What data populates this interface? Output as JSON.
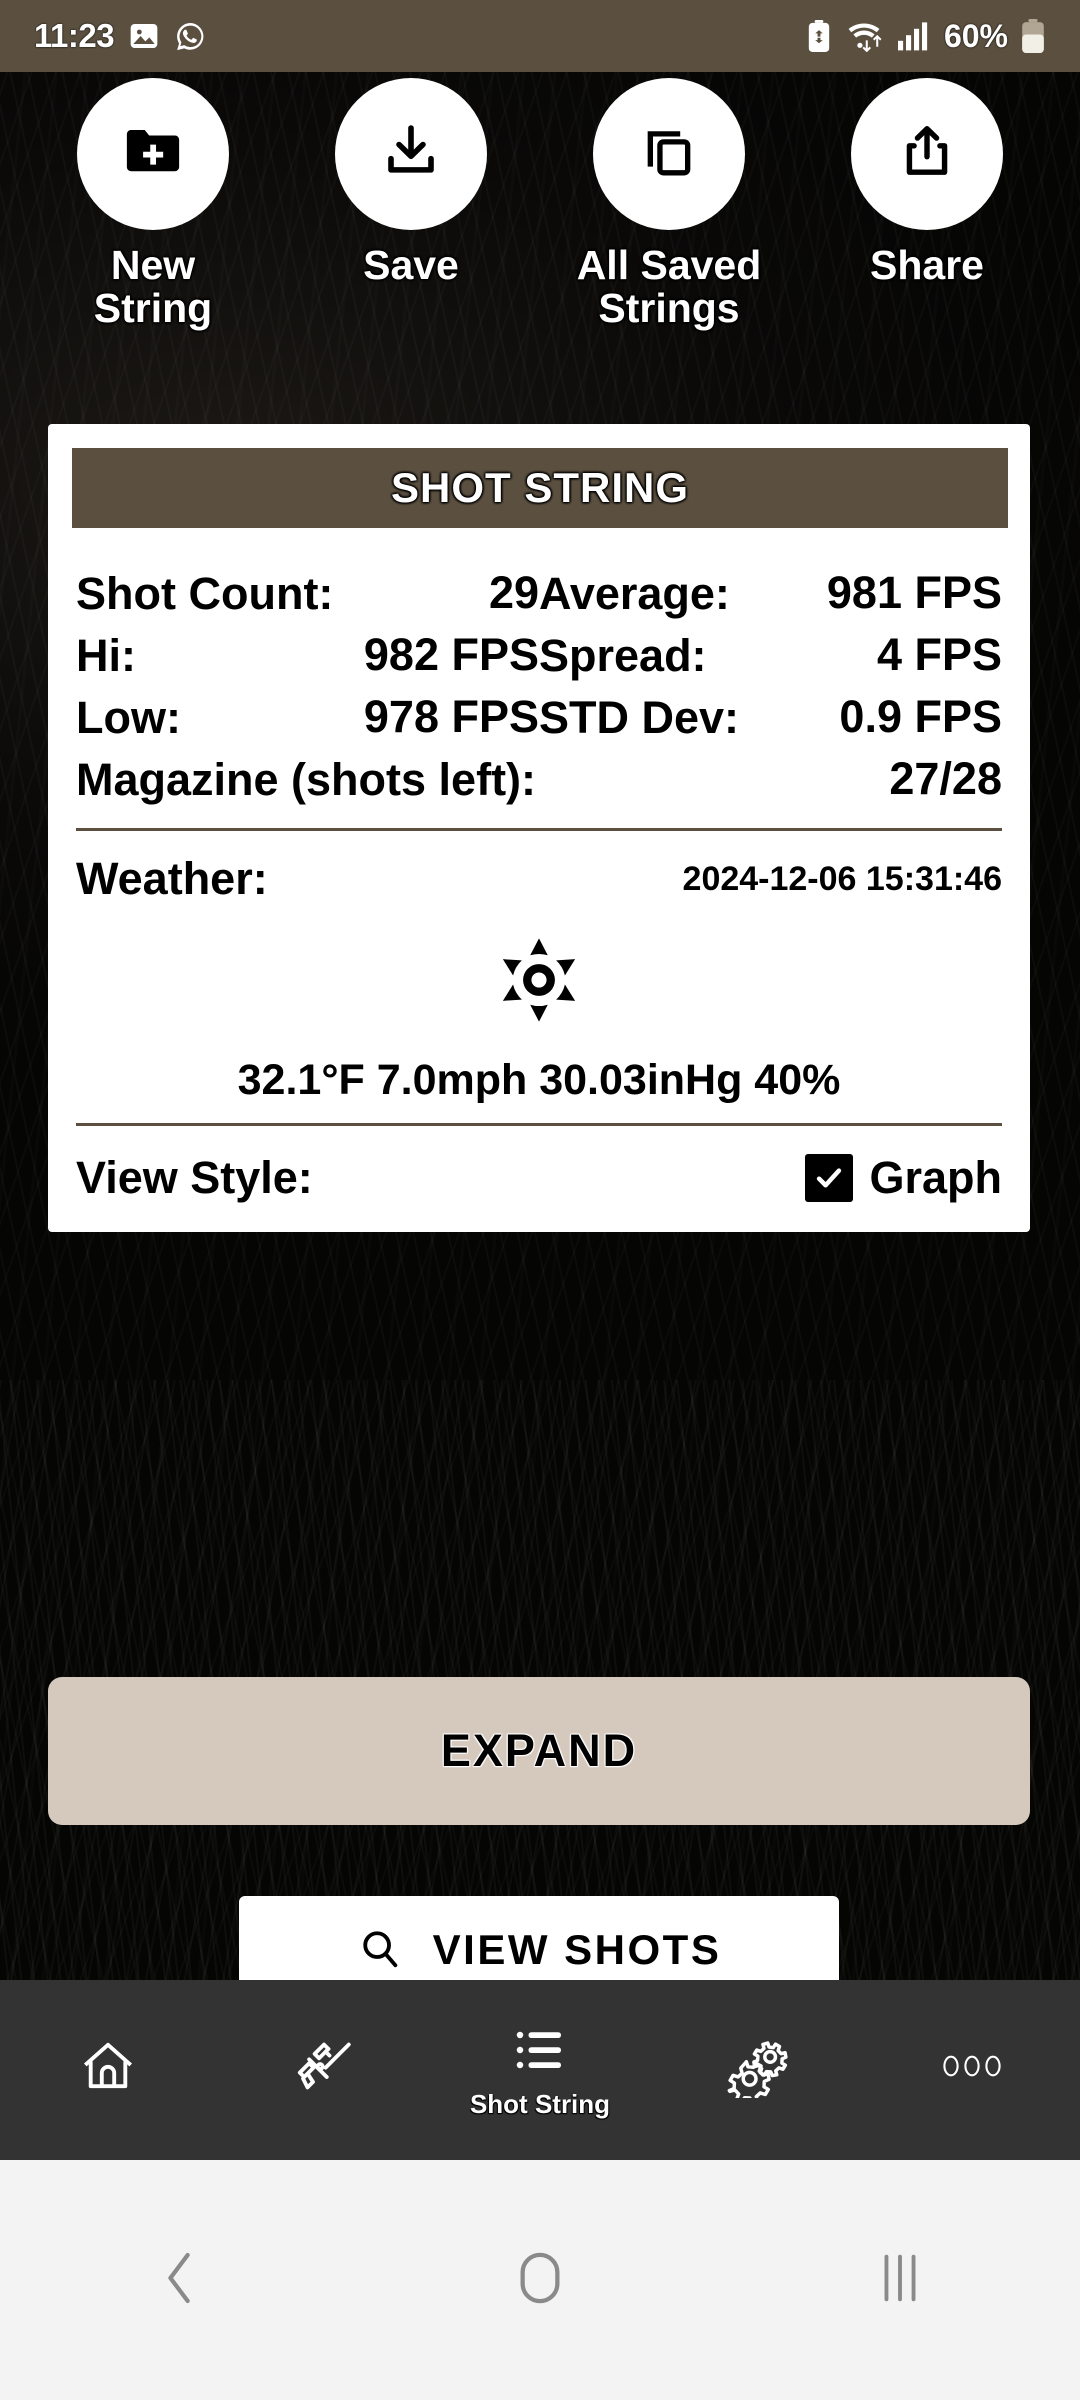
{
  "status_bar": {
    "time": "11:23",
    "battery_percent": "60%",
    "icons": [
      "photo-icon",
      "whatsapp-icon",
      "battery-saver-icon",
      "wifi-icon",
      "signal-icon",
      "battery-icon"
    ]
  },
  "actions": [
    {
      "label": "New String",
      "icon": "new-folder-icon"
    },
    {
      "label": "Save",
      "icon": "download-icon"
    },
    {
      "label": "All Saved Strings",
      "icon": "copy-icon"
    },
    {
      "label": "Share",
      "icon": "share-icon"
    }
  ],
  "card": {
    "title": "SHOT STRING",
    "stats": [
      {
        "label": "Shot Count:",
        "value": "29"
      },
      {
        "label": "Average:",
        "value": "981 FPS"
      },
      {
        "label": "Hi:",
        "value": "982 FPS"
      },
      {
        "label": "Spread:",
        "value": "4 FPS"
      },
      {
        "label": "Low:",
        "value": "978 FPS"
      },
      {
        "label": "STD Dev:",
        "value": "0.9 FPS"
      }
    ],
    "magazine": {
      "label": "Magazine (shots left):",
      "value": "27/28"
    },
    "weather": {
      "label": "Weather:",
      "timestamp": "2024-12-06 15:31:46",
      "icon": "sun-icon",
      "readings": "32.1°F 7.0mph 30.03inHg 40%"
    },
    "view_style": {
      "label": "View Style:",
      "option": "Graph",
      "checked": true
    }
  },
  "buttons": {
    "expand": "EXPAND",
    "view_shots": "VIEW SHOTS",
    "view_shots_icon": "search-icon"
  },
  "bottom_nav": [
    {
      "label": "",
      "icon": "home-icon",
      "active": false
    },
    {
      "label": "",
      "icon": "rifle-icon",
      "active": false
    },
    {
      "label": "Shot String",
      "icon": "list-icon",
      "active": true
    },
    {
      "label": "",
      "icon": "gears-icon",
      "active": false
    },
    {
      "label": "",
      "icon": "more-icon",
      "active": false
    }
  ],
  "android_nav": [
    {
      "icon": "back-icon"
    },
    {
      "icon": "home-circle-icon"
    },
    {
      "icon": "recents-icon"
    }
  ],
  "colors": {
    "accent_brown": "#5b5040",
    "expand_button": "#d5c8bd",
    "nav_bar": "#333333",
    "android_nav": "#f3f3f3"
  }
}
